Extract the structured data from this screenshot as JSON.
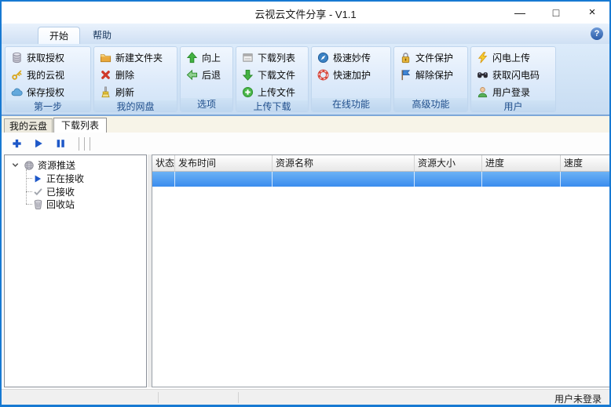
{
  "window": {
    "title": "云视云文件分享 - V1.1",
    "controls": {
      "minimize": "—",
      "maximize": "□",
      "close": "×"
    }
  },
  "help": {
    "glyph": "?"
  },
  "ribbon_tabs": [
    {
      "label": "开始",
      "active": true
    },
    {
      "label": "帮助",
      "active": false
    }
  ],
  "ribbon": {
    "groups": [
      {
        "caption": "第一步",
        "buttons": [
          {
            "label": "获取授权",
            "icon": "database-icon"
          },
          {
            "label": "我的云视",
            "icon": "key-icon"
          },
          {
            "label": "保存授权",
            "icon": "cloud-icon"
          }
        ]
      },
      {
        "caption": "我的网盘",
        "buttons": [
          {
            "label": "新建文件夹",
            "icon": "new-folder-icon"
          },
          {
            "label": "删除",
            "icon": "delete-icon"
          },
          {
            "label": "刷新",
            "icon": "refresh-icon"
          }
        ]
      },
      {
        "caption": "选项",
        "buttons": [
          {
            "label": "向上",
            "icon": "up-arrow-icon"
          },
          {
            "label": "后退",
            "icon": "back-arrow-icon"
          }
        ]
      },
      {
        "caption": "上传下载",
        "buttons": [
          {
            "label": "下载列表",
            "icon": "download-list-icon"
          },
          {
            "label": "下载文件",
            "icon": "download-file-icon"
          },
          {
            "label": "上传文件",
            "icon": "upload-file-icon"
          }
        ]
      },
      {
        "caption": "在线功能",
        "buttons": [
          {
            "label": "极速妙传",
            "icon": "compass-icon"
          },
          {
            "label": "快速加护",
            "icon": "lifebuoy-icon"
          }
        ]
      },
      {
        "caption": "高级功能",
        "buttons": [
          {
            "label": "文件保护",
            "icon": "lock-icon"
          },
          {
            "label": "解除保护",
            "icon": "flag-icon"
          }
        ]
      },
      {
        "caption": "用户",
        "buttons": [
          {
            "label": "闪电上传",
            "icon": "lightning-icon"
          },
          {
            "label": "获取闪电码",
            "icon": "binoculars-icon"
          },
          {
            "label": "用户登录",
            "icon": "user-icon"
          }
        ]
      }
    ]
  },
  "page_tabs": [
    {
      "label": "我的云盘",
      "active": false
    },
    {
      "label": "下载列表",
      "active": true
    }
  ],
  "toolbar": {
    "buttons": [
      {
        "icon": "add-icon"
      },
      {
        "icon": "play-icon"
      },
      {
        "icon": "pause-icon"
      }
    ]
  },
  "tree": {
    "root": {
      "label": "资源推送",
      "icon": "resource-push-icon",
      "expanded": true
    },
    "items": [
      {
        "label": "正在接收",
        "icon": "receiving-icon"
      },
      {
        "label": "已接收",
        "icon": "received-check-icon"
      },
      {
        "label": "回收站",
        "icon": "recycle-bin-icon"
      }
    ]
  },
  "table": {
    "columns": [
      "状态",
      "发布时间",
      "资源名称",
      "资源大小",
      "进度",
      "速度"
    ],
    "rows": [
      {
        "selected": true,
        "cells": [
          "",
          "",
          "",
          "",
          "",
          ""
        ]
      }
    ]
  },
  "status_bar": {
    "user_status": "用户未登录"
  },
  "colors": {
    "window_border": "#1779d2",
    "ribbon_background": "#d4e4f5",
    "group_caption_text": "#1f4e8c",
    "selection_gradient_top": "#6cb2f5",
    "selection_gradient_bottom": "#3a8cee",
    "toolbar_icon_blue": "#1e58c8",
    "page_tab_strip": "#f7f4e8"
  }
}
